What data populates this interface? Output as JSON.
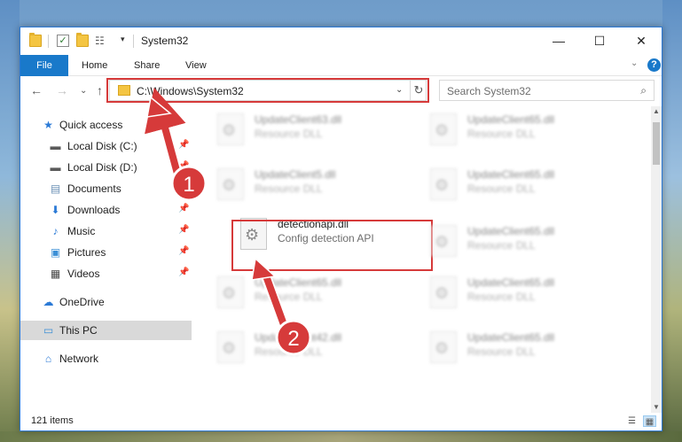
{
  "titlebar": {
    "title": "System32",
    "qa_dropdown": "▾",
    "minimize": "—",
    "maximize": "☐",
    "close": "✕"
  },
  "ribbon": {
    "file": "File",
    "tabs": [
      "Home",
      "Share",
      "View"
    ],
    "expand": "⌄",
    "help": "?"
  },
  "navbar": {
    "back": "←",
    "forward": "→",
    "recent": "⌄",
    "up": "↑",
    "address": "C:\\Windows\\System32",
    "address_dropdown": "⌄",
    "refresh": "↻",
    "search_placeholder": "Search System32",
    "search_icon": "⌕"
  },
  "sidebar": {
    "items": [
      {
        "label": "Quick access",
        "icon": "star-icon",
        "glyph": "★",
        "color": "#2b7ad6",
        "pinned": false
      },
      {
        "label": "Local Disk (C:)",
        "icon": "drive-icon",
        "glyph": "▬",
        "color": "#5a5a5a",
        "pinned": true
      },
      {
        "label": "Local Disk (D:)",
        "icon": "drive-icon",
        "glyph": "▬",
        "color": "#5a5a5a",
        "pinned": true
      },
      {
        "label": "Documents",
        "icon": "documents-icon",
        "glyph": "▤",
        "color": "#6a8fb5",
        "pinned": true
      },
      {
        "label": "Downloads",
        "icon": "downloads-icon",
        "glyph": "⬇",
        "color": "#2b7ad6",
        "pinned": true
      },
      {
        "label": "Music",
        "icon": "music-icon",
        "glyph": "♪",
        "color": "#2b7ad6",
        "pinned": true
      },
      {
        "label": "Pictures",
        "icon": "pictures-icon",
        "glyph": "▣",
        "color": "#3b8fd6",
        "pinned": true
      },
      {
        "label": "Videos",
        "icon": "videos-icon",
        "glyph": "▦",
        "color": "#444444",
        "pinned": true
      },
      {
        "label": "OneDrive",
        "icon": "cloud-icon",
        "glyph": "☁",
        "color": "#2b7ad6",
        "pinned": false
      },
      {
        "label": "This PC",
        "icon": "computer-icon",
        "glyph": "▭",
        "color": "#3b8fd6",
        "pinned": false
      },
      {
        "label": "Network",
        "icon": "network-icon",
        "glyph": "⌂",
        "color": "#2b7ad6",
        "pinned": false
      }
    ],
    "pin_glyph": "📌"
  },
  "content": {
    "files": [
      {
        "name": "UpdateClient63.dll",
        "desc": "Resource DLL"
      },
      {
        "name": "UpdateClient65.dll",
        "desc": "Resource DLL"
      },
      {
        "name": "UpdateClient5.dll",
        "desc": "Resource DLL"
      },
      {
        "name": "UpdateClient65.dll",
        "desc": "Resource DLL"
      },
      {
        "name": "detectionapi.dll",
        "desc": "Config detection API"
      },
      {
        "name": "UpdateClient65.dll",
        "desc": "Resource DLL"
      },
      {
        "name": "UpdateClient65.dll",
        "desc": "Resource DLL"
      },
      {
        "name": "UpdateClient65.dll",
        "desc": "Resource DLL"
      },
      {
        "name": "UpdateClient42.dll",
        "desc": "Resource DLL"
      },
      {
        "name": "UpdateClient65.dll",
        "desc": "Resource DLL"
      }
    ],
    "gear": "⚙"
  },
  "scrollbar": {
    "up": "▲",
    "down": "▼"
  },
  "status": {
    "items_count": "121 items",
    "details_view": "☰",
    "tiles_view": "▦"
  },
  "annotations": {
    "step1": "1",
    "step2": "2",
    "color": "#d63a3a"
  }
}
